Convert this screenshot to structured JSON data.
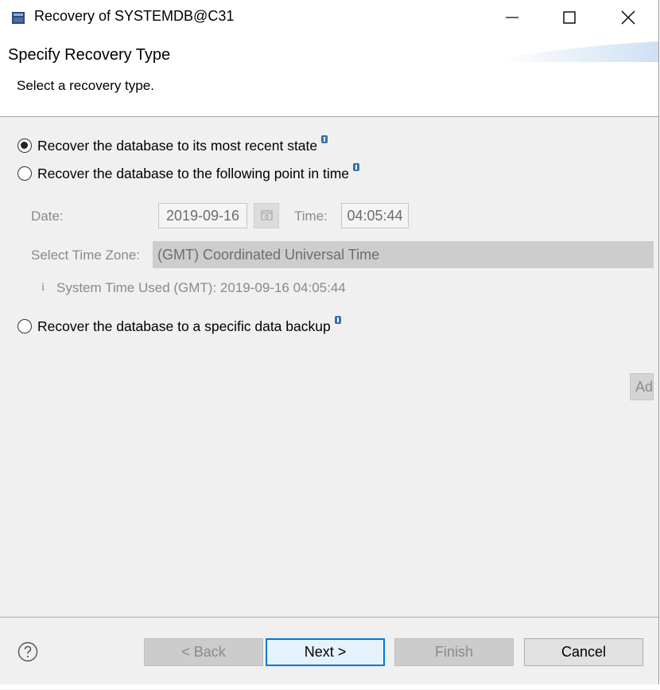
{
  "window": {
    "title": "Recovery of SYSTEMDB@C31",
    "icons": {
      "app": "database-icon",
      "minimize": "minimize-icon",
      "maximize": "maximize-icon",
      "close": "close-icon"
    }
  },
  "header": {
    "title": "Specify Recovery Type",
    "description": "Select a recovery type."
  },
  "options": [
    {
      "label": "Recover the database to its most recent state",
      "selected": true
    },
    {
      "label": "Recover the database to the following point in time",
      "selected": false
    },
    {
      "label": "Recover the database to a specific data backup",
      "selected": false
    }
  ],
  "point_in_time": {
    "date_label": "Date:",
    "date_value": "2019-09-16",
    "time_label": "Time:",
    "time_value": "04:05:44",
    "timezone_label": "Select Time Zone:",
    "timezone_value": "(GMT) Coordinated Universal Time",
    "system_time_icon": "i",
    "system_time_text": "System Time Used (GMT): 2019-09-16 04:05:44"
  },
  "backup": {
    "add_button": "Ad"
  },
  "footer": {
    "back": "< Back",
    "next": "Next >",
    "finish": "Finish",
    "cancel": "Cancel"
  },
  "colors": {
    "accent": "#0078d7",
    "info_badge": "#3a6fb0",
    "disabled_text": "#8a8a8a"
  }
}
